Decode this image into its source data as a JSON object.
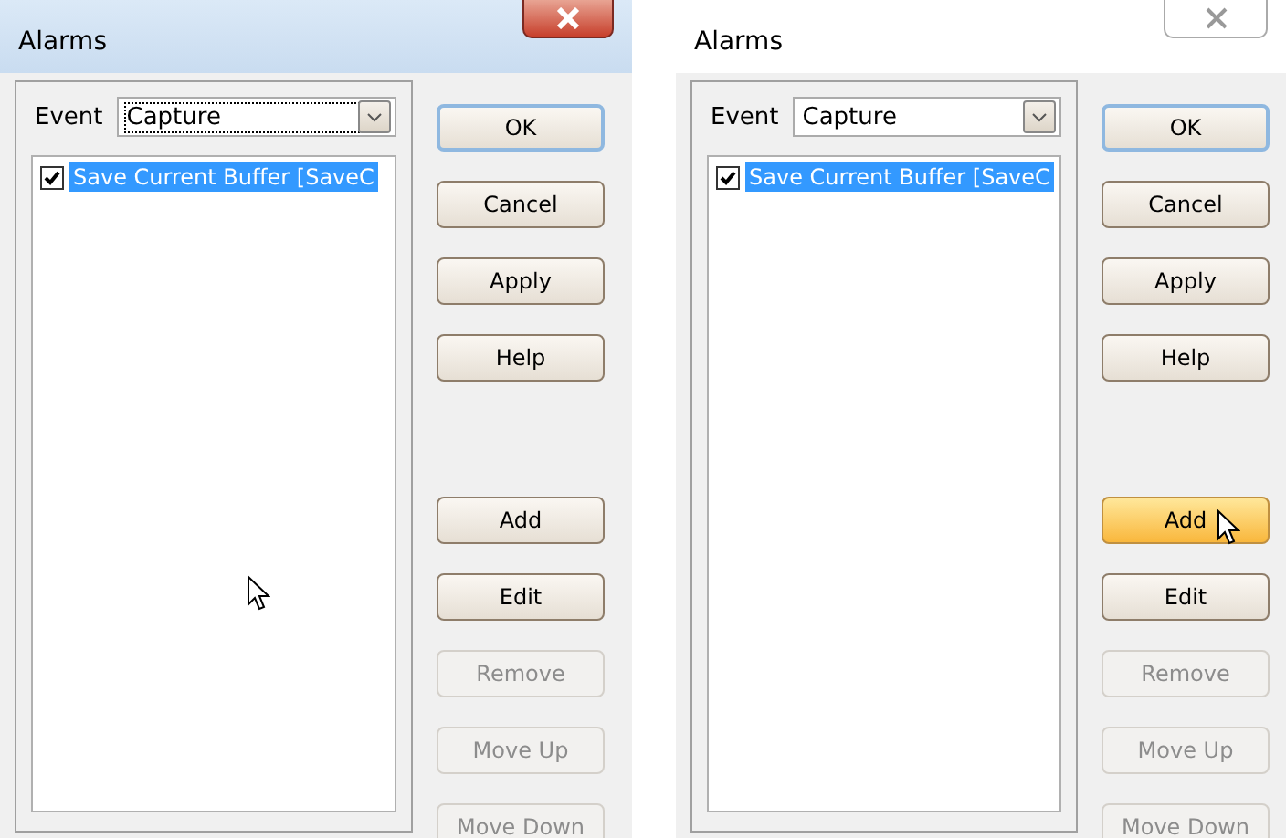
{
  "dialogs": [
    {
      "title": "Alarms",
      "close_highlighted": true,
      "event_label": "Event",
      "event_value": "Capture",
      "items": [
        {
          "label": "Save Current Buffer [SaveC",
          "checked": true,
          "selected": true
        }
      ],
      "buttons": [
        {
          "label": "OK",
          "default": true,
          "disabled": false,
          "hovered": false
        },
        {
          "label": "Cancel",
          "default": false,
          "disabled": false,
          "hovered": false
        },
        {
          "label": "Apply",
          "default": false,
          "disabled": false,
          "hovered": false
        },
        {
          "label": "Help",
          "default": false,
          "disabled": false,
          "hovered": false
        },
        {
          "label": "Add",
          "default": false,
          "disabled": false,
          "hovered": false
        },
        {
          "label": "Edit",
          "default": false,
          "disabled": false,
          "hovered": false
        },
        {
          "label": "Remove",
          "default": false,
          "disabled": true,
          "hovered": false
        },
        {
          "label": "Move Up",
          "default": false,
          "disabled": true,
          "hovered": false
        },
        {
          "label": "Move Down",
          "default": false,
          "disabled": true,
          "hovered": false
        }
      ]
    },
    {
      "title": "Alarms",
      "close_highlighted": false,
      "event_label": "Event",
      "event_value": "Capture",
      "items": [
        {
          "label": "Save Current Buffer [SaveC",
          "checked": true,
          "selected": true
        }
      ],
      "buttons": [
        {
          "label": "OK",
          "default": true,
          "disabled": false,
          "hovered": false
        },
        {
          "label": "Cancel",
          "default": false,
          "disabled": false,
          "hovered": false
        },
        {
          "label": "Apply",
          "default": false,
          "disabled": false,
          "hovered": false
        },
        {
          "label": "Help",
          "default": false,
          "disabled": false,
          "hovered": false
        },
        {
          "label": "Add",
          "default": false,
          "disabled": false,
          "hovered": true
        },
        {
          "label": "Edit",
          "default": false,
          "disabled": false,
          "hovered": false
        },
        {
          "label": "Remove",
          "default": false,
          "disabled": true,
          "hovered": false
        },
        {
          "label": "Move Up",
          "default": false,
          "disabled": true,
          "hovered": false
        },
        {
          "label": "Move Down",
          "default": false,
          "disabled": true,
          "hovered": false
        }
      ]
    }
  ]
}
